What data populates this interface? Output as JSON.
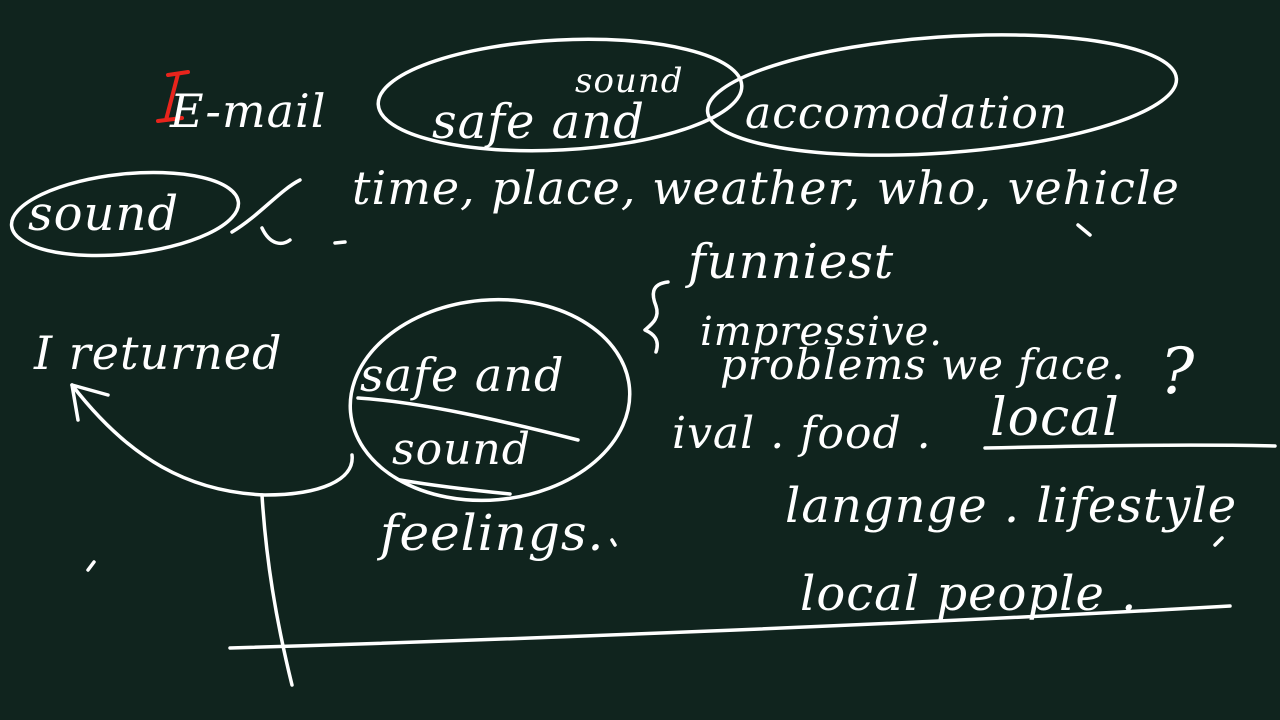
{
  "board": {
    "background": "#10241e",
    "ink_color": "#ffffff",
    "accent_color": "#e8241c"
  },
  "line1": {
    "email": "E-mail",
    "sound_small": "sound",
    "safe_and": "safe and",
    "accommodation": "accomodation"
  },
  "line2": {
    "sound": "sound",
    "list": "time, place, weather, who, vehicle"
  },
  "left_block": {
    "i_returned": "I returned",
    "safe_and": "safe and",
    "sound": "sound",
    "feelings": "feelings."
  },
  "right_block": {
    "funniest": "funniest",
    "impressive": "impressive.",
    "problems": "problems we face.",
    "question_mark": "?",
    "festival_food": "ival . food . ",
    "local": "local",
    "language_lifestyle": "langnge . lifestyle",
    "local_people": "local people ."
  }
}
